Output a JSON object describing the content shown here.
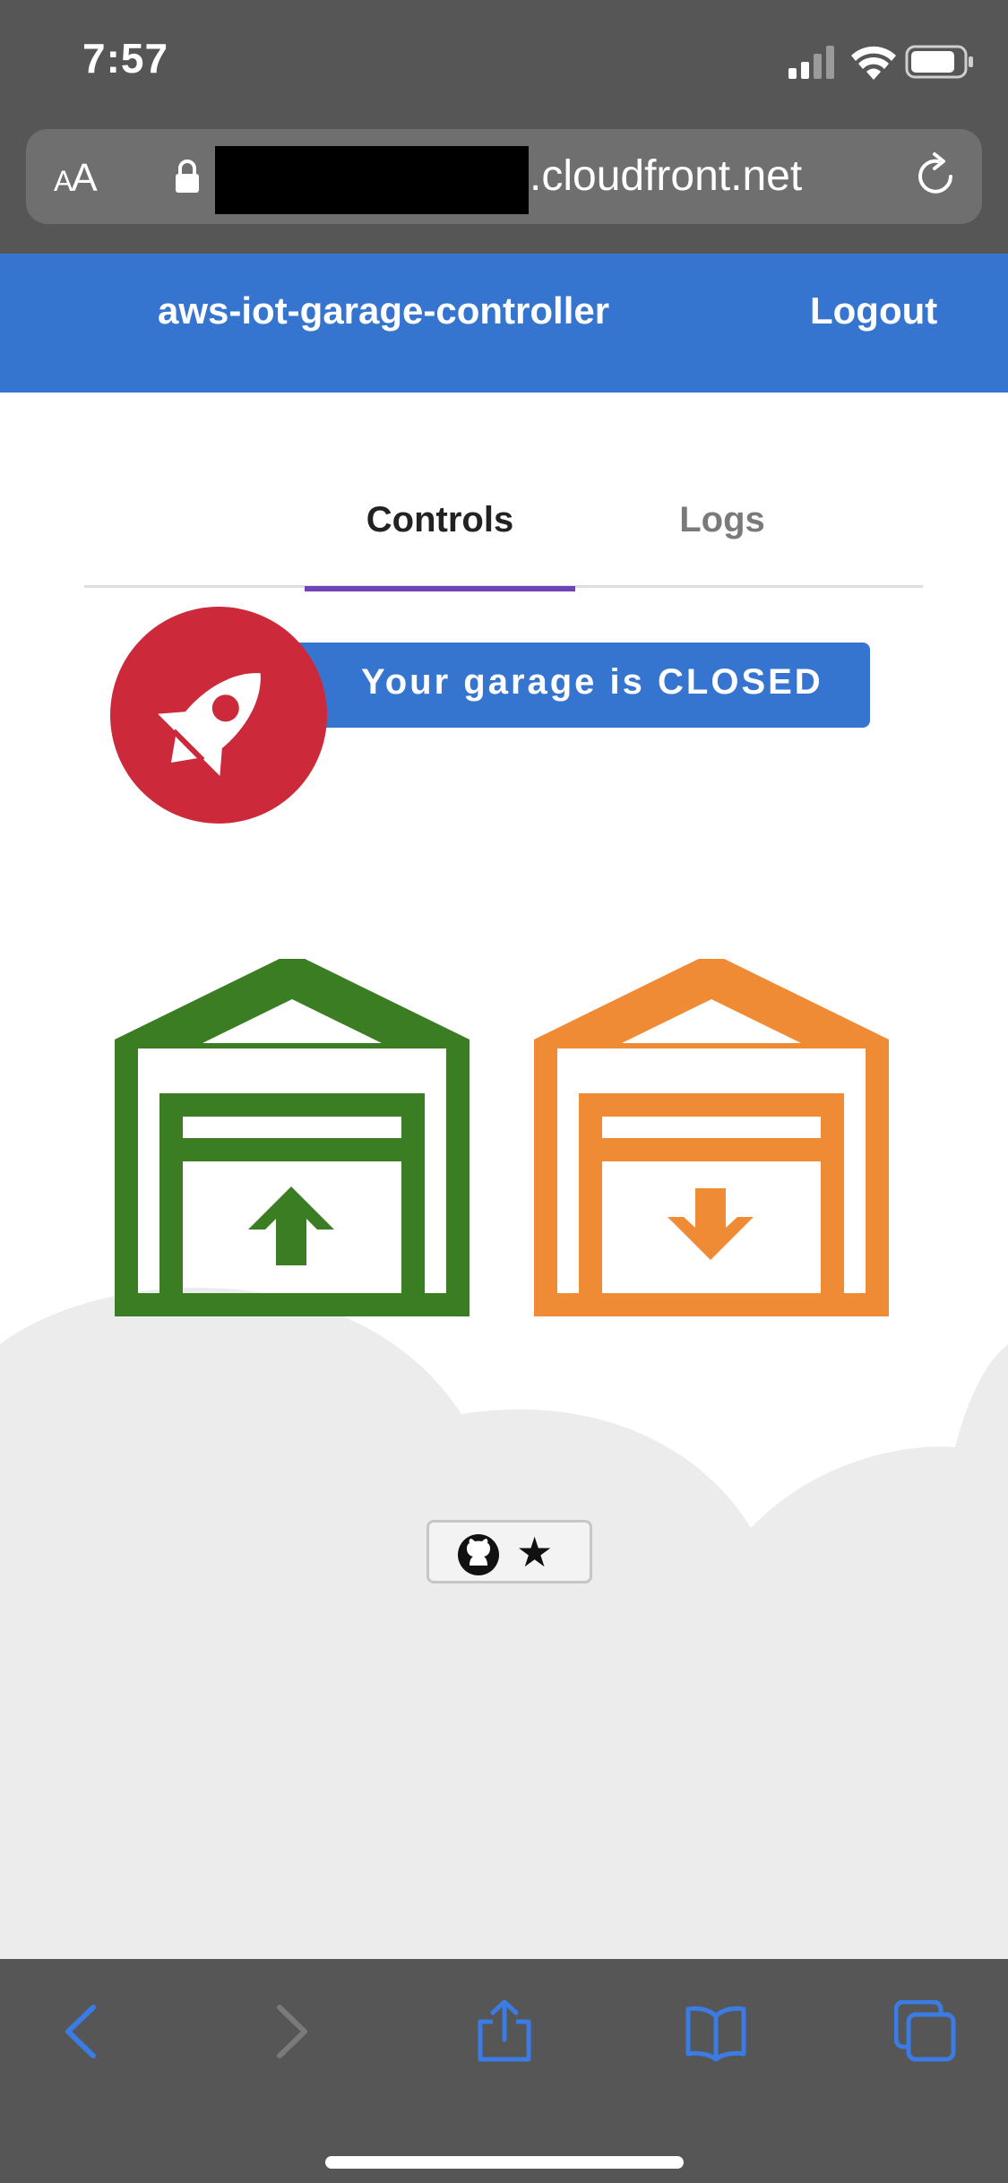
{
  "status_bar": {
    "time": "7:57"
  },
  "browser": {
    "text_size_label_small": "A",
    "text_size_label_large": "A",
    "url_domain": ".cloudfront.net",
    "accent_color": "#3a7be4"
  },
  "app": {
    "title": "aws-iot-garage-controller",
    "logout_label": "Logout",
    "header_color": "#3675cf"
  },
  "tabs": [
    {
      "label": "Controls",
      "active": true
    },
    {
      "label": "Logs",
      "active": false
    }
  ],
  "garage": {
    "status_text": "Your garage is CLOSED",
    "state": "CLOSED",
    "open_button": {
      "icon": "garage-open-up-arrow-icon",
      "color": "#3a7d23"
    },
    "close_button": {
      "icon": "garage-close-down-arrow-icon",
      "color": "#f08b35"
    },
    "badge_icon": "rocket-icon",
    "badge_color": "#cc2a3a"
  },
  "footer": {
    "github_button": {
      "icons": [
        "github-icon",
        "star-icon"
      ],
      "star_glyph": "★"
    }
  }
}
